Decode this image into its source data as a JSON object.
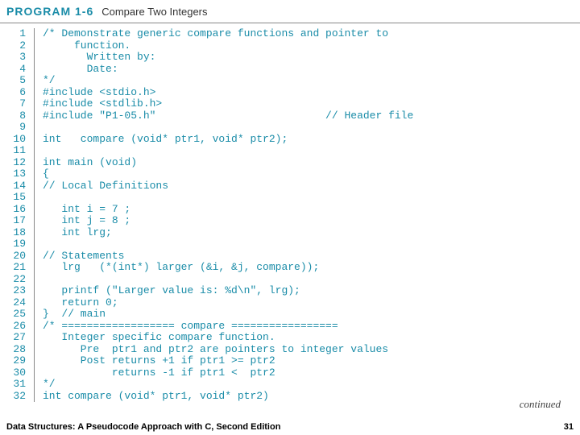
{
  "header": {
    "label": "PROGRAM 1-6",
    "title": "Compare Two Integers"
  },
  "code_lines": [
    "/* Demonstrate generic compare functions and pointer to",
    "     function.",
    "       Written by:",
    "       Date:",
    "*/",
    "#include <stdio.h>",
    "#include <stdlib.h>",
    "#include \"P1-05.h\"                           // Header file",
    "",
    "int   compare (void* ptr1, void* ptr2);",
    "",
    "int main (void)",
    "{",
    "// Local Definitions",
    "",
    "   int i = 7 ;",
    "   int j = 8 ;",
    "   int lrg;",
    "",
    "// Statements",
    "   lrg   (*(int*) larger (&i, &j, compare));",
    "",
    "   printf (\"Larger value is: %d\\n\", lrg);",
    "   return 0;",
    "}  // main",
    "/* ================== compare =================",
    "   Integer specific compare function.",
    "      Pre  ptr1 and ptr2 are pointers to integer values",
    "      Post returns +1 if ptr1 >= ptr2",
    "           returns -1 if ptr1 <  ptr2",
    "*/",
    "int compare (void* ptr1, void* ptr2)"
  ],
  "continued": "continued",
  "footer": {
    "left": "Data Structures: A Pseudocode Approach with C, Second Edition",
    "right": "31"
  }
}
